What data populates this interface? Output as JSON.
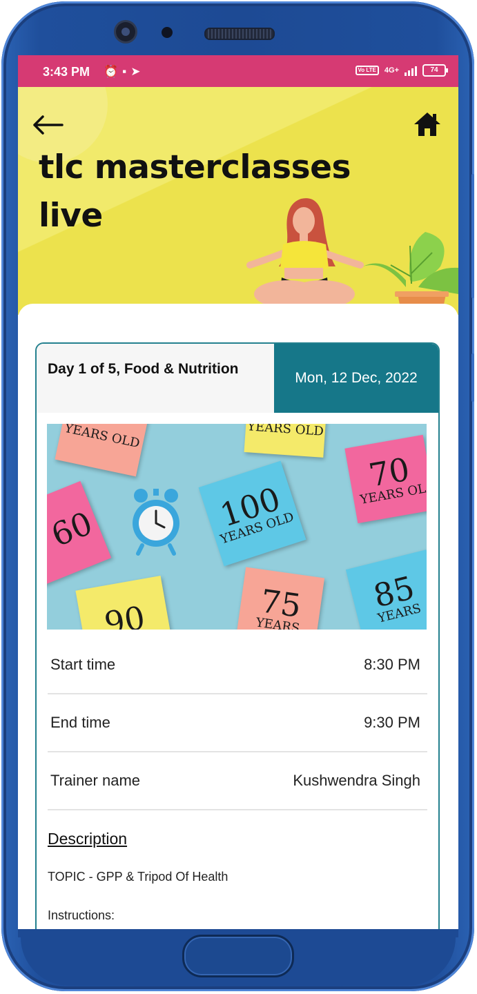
{
  "status_bar": {
    "time": "3:43 PM",
    "network": "4G+",
    "volte": "Vo LTE",
    "battery": "74"
  },
  "header": {
    "title_line1": "tlc masterclasses",
    "title_line2": "live",
    "bg_color": "#ece24d"
  },
  "session": {
    "day_label": "Day 1 of 5, Food & Nutrition",
    "date": "Mon, 12 Dec, 2022",
    "image_notes": [
      {
        "num": "",
        "sub": "YEARS OLD"
      },
      {
        "num": "",
        "sub": "YEARS OLD"
      },
      {
        "num": "70",
        "sub": "YEARS OL"
      },
      {
        "num": "100",
        "sub": "YEARS OLD"
      },
      {
        "num": "60",
        "sub": ""
      },
      {
        "num": "75",
        "sub": "YEARS"
      },
      {
        "num": "85",
        "sub": "YEARS"
      },
      {
        "num": "90",
        "sub": ""
      }
    ],
    "details": [
      {
        "label": "Start time",
        "value": "8:30 PM"
      },
      {
        "label": "End time",
        "value": "9:30 PM"
      },
      {
        "label": "Trainer name",
        "value": "Kushwendra Singh"
      }
    ],
    "description_title": "Description",
    "description_topic": "TOPIC - GPP & Tripod Of Health",
    "description_instructions": "Instructions:"
  },
  "colors": {
    "status_bar": "#d63a73",
    "accent": "#167789",
    "phone_frame": "#1d4a94"
  },
  "icons": [
    "back-arrow-icon",
    "home-icon",
    "alarm-icon",
    "message-icon",
    "navigation-icon",
    "signal-icon",
    "battery-icon",
    "alarm-clock-icon"
  ]
}
